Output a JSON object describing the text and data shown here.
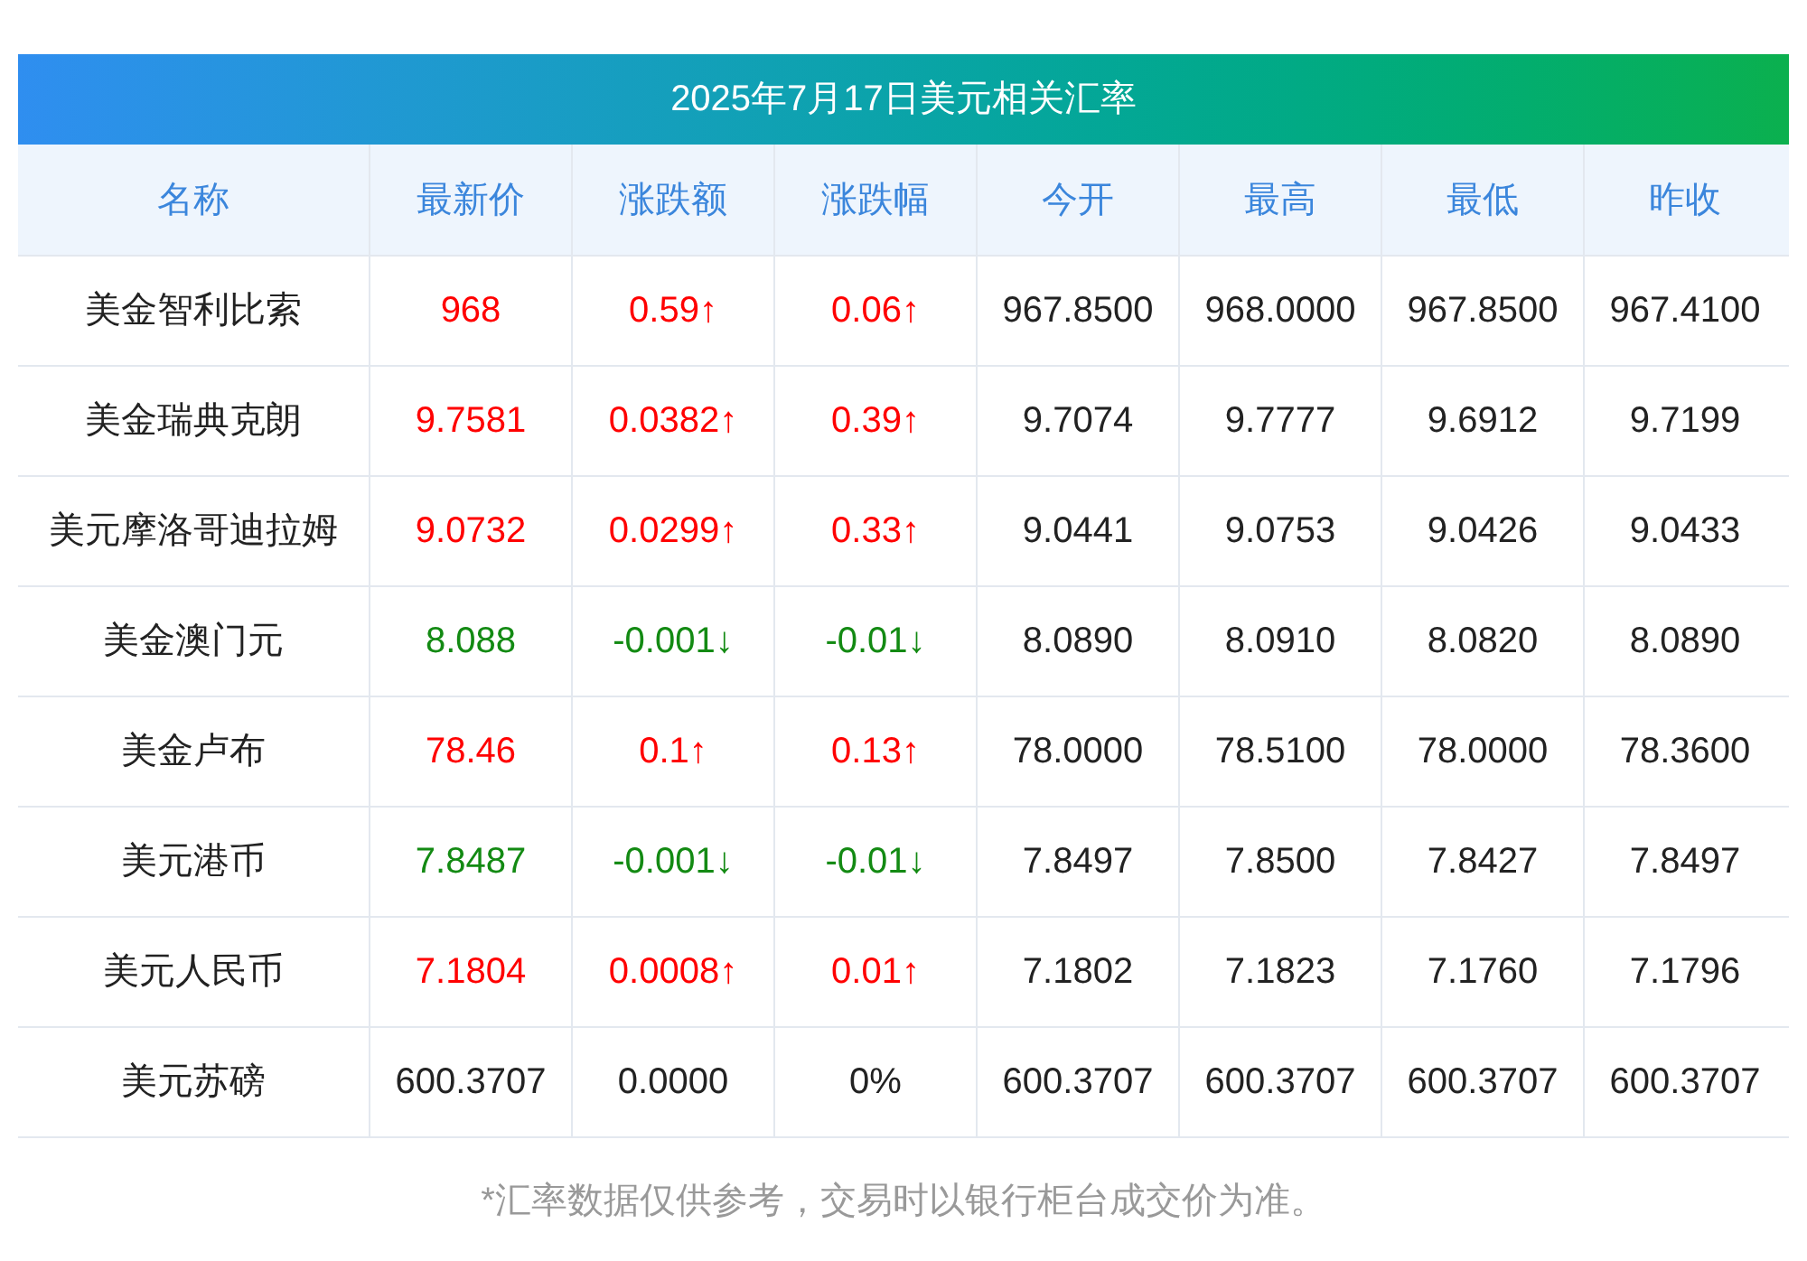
{
  "title": "2025年7月17日美元相关汇率",
  "columns": [
    "名称",
    "最新价",
    "涨跌额",
    "涨跌幅",
    "今开",
    "最高",
    "最低",
    "昨收"
  ],
  "rows": [
    {
      "color": "#ff0000",
      "cells": [
        "美金智利比索",
        "968",
        "0.59↑",
        "0.06↑",
        "967.8500",
        "968.0000",
        "967.8500",
        "967.4100"
      ]
    },
    {
      "color": "#ff0000",
      "cells": [
        "美金瑞典克朗",
        "9.7581",
        "0.0382↑",
        "0.39↑",
        "9.7074",
        "9.7777",
        "9.6912",
        "9.7199"
      ]
    },
    {
      "color": "#ff0000",
      "cells": [
        "美元摩洛哥迪拉姆",
        "9.0732",
        "0.0299↑",
        "0.33↑",
        "9.0441",
        "9.0753",
        "9.0426",
        "9.0433"
      ]
    },
    {
      "color": "#138a13",
      "cells": [
        "美金澳门元",
        "8.088",
        "-0.001↓",
        "-0.01↓",
        "8.0890",
        "8.0910",
        "8.0820",
        "8.0890"
      ]
    },
    {
      "color": "#ff0000",
      "cells": [
        "美金卢布",
        "78.46",
        "0.1↑",
        "0.13↑",
        "78.0000",
        "78.5100",
        "78.0000",
        "78.3600"
      ]
    },
    {
      "color": "#138a13",
      "cells": [
        "美元港币",
        "7.8487",
        "-0.001↓",
        "-0.01↓",
        "7.8497",
        "7.8500",
        "7.8427",
        "7.8497"
      ]
    },
    {
      "color": "#ff0000",
      "cells": [
        "美元人民币",
        "7.1804",
        "0.0008↑",
        "0.01↑",
        "7.1802",
        "7.1823",
        "7.1760",
        "7.1796"
      ]
    },
    {
      "color": "#222222",
      "cells": [
        "美元苏磅",
        "600.3707",
        "0.0000",
        "0%",
        "600.3707",
        "600.3707",
        "600.3707",
        "600.3707"
      ]
    }
  ],
  "note": "*汇率数据仅供参考，交易时以银行柜台成交价为准。"
}
